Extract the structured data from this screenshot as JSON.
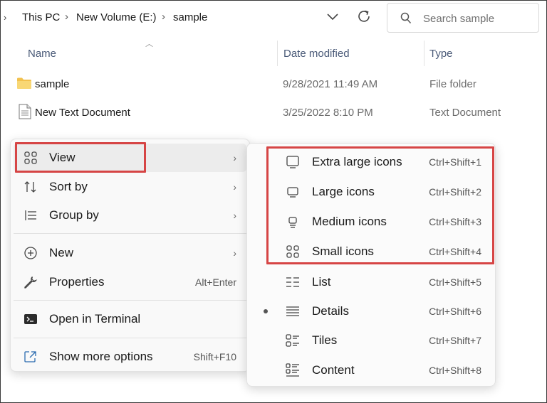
{
  "address_bar": {
    "breadcrumb": [
      "This PC",
      "New Volume (E:)",
      "sample"
    ]
  },
  "search": {
    "placeholder": "Search sample"
  },
  "columns": [
    "Name",
    "Date modified",
    "Type"
  ],
  "files": [
    {
      "name": "sample",
      "date": "9/28/2021 11:49 AM",
      "type": "File folder",
      "icon": "folder-icon"
    },
    {
      "name": "New Text Document",
      "date": "3/25/2022 8:10 PM",
      "type": "Text Document",
      "icon": "text-document-icon"
    }
  ],
  "context_menu": {
    "items": [
      {
        "label": "View",
        "icon": "view-grid-icon",
        "submenu": true,
        "highlighted": true
      },
      {
        "label": "Sort by",
        "icon": "sort-icon",
        "submenu": true
      },
      {
        "label": "Group by",
        "icon": "group-icon",
        "submenu": true
      },
      {
        "label": "New",
        "icon": "new-plus-icon",
        "submenu": true
      },
      {
        "label": "Properties",
        "icon": "wrench-icon",
        "shortcut": "Alt+Enter"
      },
      {
        "label": "Open in Terminal",
        "icon": "terminal-icon"
      },
      {
        "label": "Show more options",
        "icon": "share-icon",
        "shortcut": "Shift+F10"
      }
    ]
  },
  "view_submenu": {
    "items": [
      {
        "label": "Extra large icons",
        "shortcut": "Ctrl+Shift+1",
        "icon": "extra-large-icons-icon"
      },
      {
        "label": "Large icons",
        "shortcut": "Ctrl+Shift+2",
        "icon": "large-icons-icon"
      },
      {
        "label": "Medium icons",
        "shortcut": "Ctrl+Shift+3",
        "icon": "medium-icons-icon"
      },
      {
        "label": "Small icons",
        "shortcut": "Ctrl+Shift+4",
        "icon": "small-icons-icon"
      },
      {
        "label": "List",
        "shortcut": "Ctrl+Shift+5",
        "icon": "list-icon"
      },
      {
        "label": "Details",
        "shortcut": "Ctrl+Shift+6",
        "icon": "details-icon",
        "selected": true
      },
      {
        "label": "Tiles",
        "shortcut": "Ctrl+Shift+7",
        "icon": "tiles-icon"
      },
      {
        "label": "Content",
        "shortcut": "Ctrl+Shift+8",
        "icon": "content-icon"
      }
    ]
  },
  "colors": {
    "highlight": "#d64545",
    "folder": "#f2c14e",
    "header_text": "#4a5a78"
  }
}
